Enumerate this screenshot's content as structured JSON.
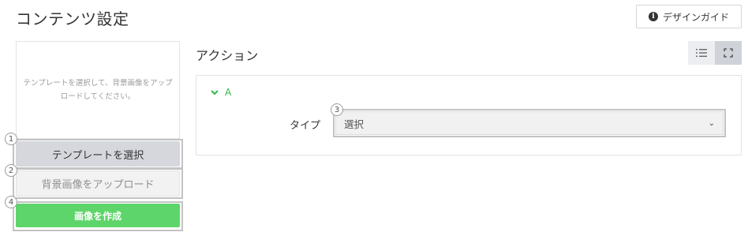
{
  "header": {
    "title": "コンテンツ設定",
    "guide_button": {
      "label": "デザインガイド",
      "icon": "info-icon"
    }
  },
  "left_panel": {
    "preview_text": "テンプレートを選択して、背景画像をアップロードしてください。",
    "buttons": {
      "select_template": "テンプレートを選択",
      "upload_background": "背景画像をアップロード",
      "create_image": "画像を作成"
    },
    "badges": {
      "select_template": "1",
      "upload_background": "2",
      "create_image": "4"
    }
  },
  "main": {
    "section_title": "アクション",
    "view_toggle": {
      "list_icon": "list-icon",
      "fullscreen_icon": "fullscreen-icon"
    },
    "action": {
      "label": "A",
      "type_label": "タイプ",
      "type_value": "選択",
      "badge": "3"
    }
  },
  "colors": {
    "accent_green": "#5ed56a",
    "action_green": "#2fb84a",
    "template_button": "#d5d7dc"
  }
}
